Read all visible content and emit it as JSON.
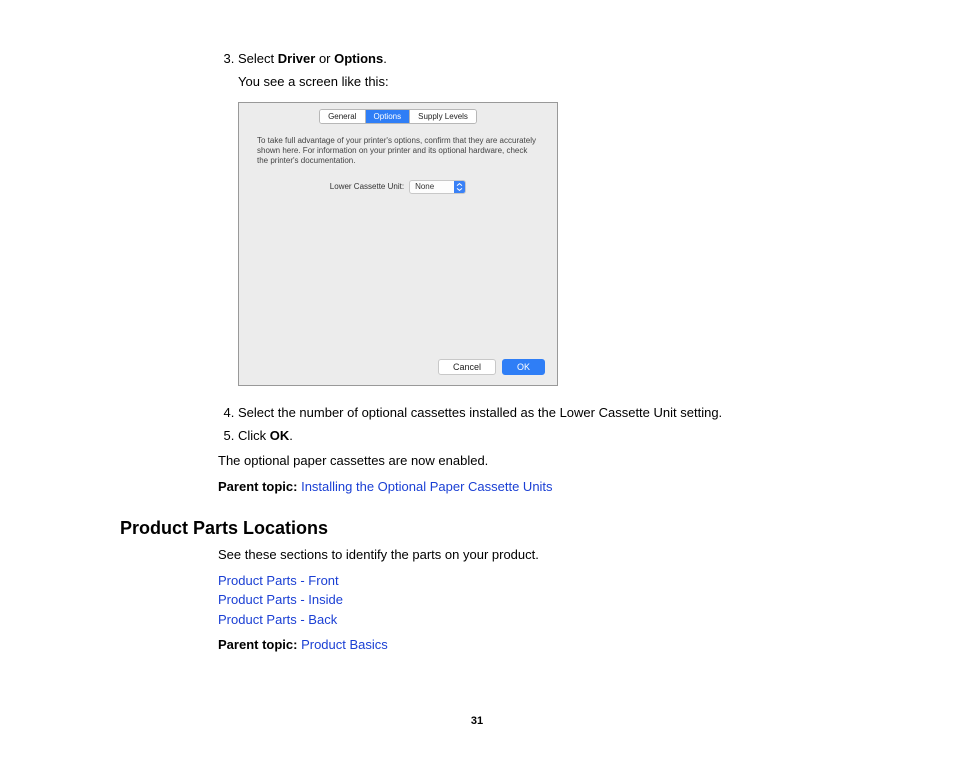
{
  "step3": {
    "prefix": "Select ",
    "bold1": "Driver",
    "mid": " or ",
    "bold2": "Options",
    "suffix": ".",
    "continuation": "You see a screen like this:"
  },
  "dialog": {
    "tabs": {
      "general": "General",
      "options": "Options",
      "supply": "Supply Levels"
    },
    "info": "To take full advantage of your printer's options, confirm that they are accurately shown here. For information on your printer and its optional hardware, check the printer's documentation.",
    "field_label": "Lower Cassette Unit:",
    "field_value": "None",
    "cancel": "Cancel",
    "ok": "OK"
  },
  "step4": "Select the number of optional cassettes installed as the Lower Cassette Unit setting.",
  "step5": {
    "prefix": "Click ",
    "bold": "OK",
    "suffix": "."
  },
  "result": "The optional paper cassettes are now enabled.",
  "parent1_label": "Parent topic: ",
  "parent1_link": "Installing the Optional Paper Cassette Units",
  "section_heading": "Product Parts Locations",
  "section_intro": "See these sections to identify the parts on your product.",
  "links": {
    "front": "Product Parts - Front",
    "inside": "Product Parts - Inside",
    "back": "Product Parts - Back"
  },
  "parent2_label": "Parent topic: ",
  "parent2_link": "Product Basics",
  "page_number": "31"
}
